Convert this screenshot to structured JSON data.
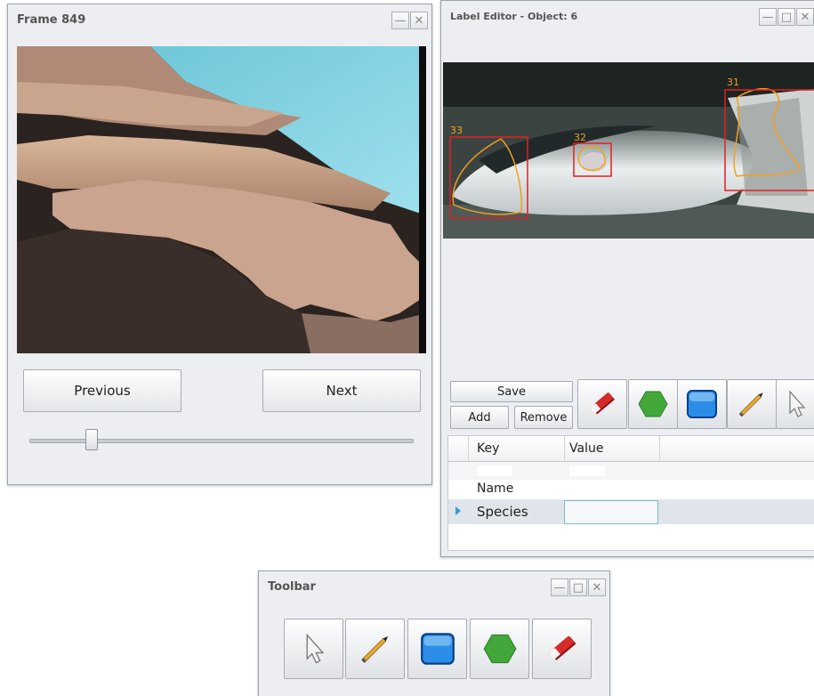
{
  "frame_window": {
    "title": "Frame 849",
    "prev_label": "Previous",
    "next_label": "Next",
    "slider_value": 0.15
  },
  "label_editor": {
    "title": "Label Editor - Object: 6",
    "regions": [
      {
        "id": "33",
        "color": "#e02020"
      },
      {
        "id": "32",
        "color": "#e02020"
      },
      {
        "id": "31",
        "color": "#e02020"
      }
    ],
    "save_label": "Save",
    "add_label": "Add",
    "remove_label": "Remove",
    "table": {
      "headers": [
        "Key",
        "Value"
      ],
      "rows": [
        {
          "key": "",
          "value": ""
        },
        {
          "key": "Name",
          "value": ""
        },
        {
          "key": "Species",
          "value": ""
        }
      ]
    }
  },
  "toolbar": {
    "title": "Toolbar",
    "tools": [
      "pointer",
      "pencil",
      "rectangle",
      "polygon",
      "eraser"
    ]
  },
  "colors": {
    "region_box": "#e02020",
    "region_outline": "#f0a020",
    "region_label": "#f0a020",
    "rect_tool": "#2a8ee8",
    "poly_tool": "#43a83a"
  }
}
